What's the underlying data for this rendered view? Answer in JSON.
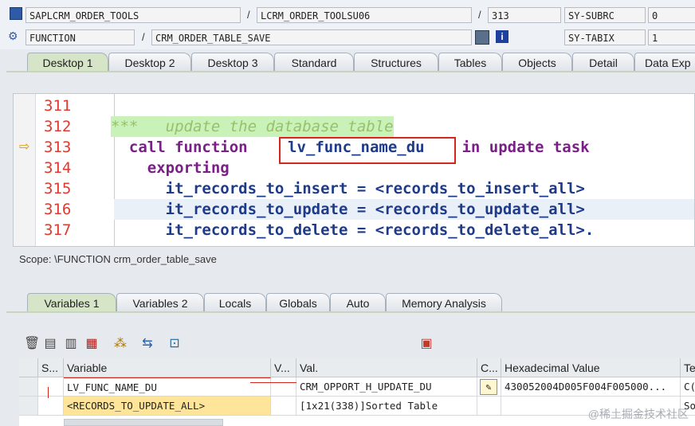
{
  "header": {
    "program": "SAPLCRM_ORDER_TOOLS",
    "include": "LCRM_ORDER_TOOLSU06",
    "line_no": "313",
    "subrc_label": "SY-SUBRC",
    "subrc_value": "0",
    "event_type": "FUNCTION",
    "event_name": "CRM_ORDER_TABLE_SAVE",
    "tabix_label": "SY-TABIX",
    "tabix_value": "1",
    "slash": "/"
  },
  "desktop_tabs": [
    "Desktop 1",
    "Desktop 2",
    "Desktop 3",
    "Standard",
    "Structures",
    "Tables",
    "Objects",
    "Detail",
    "Data Exp"
  ],
  "code_lines": [
    {
      "num": "311",
      "text": ""
    },
    {
      "num": "312",
      "text": "***   update the database table"
    },
    {
      "num": "313",
      "pre": "  call function ",
      "mid": "lv_func_name_du",
      "post": " in update task"
    },
    {
      "num": "314",
      "text": "    exporting"
    },
    {
      "num": "315",
      "text": "      it_records_to_insert = <records_to_insert_all>"
    },
    {
      "num": "316",
      "text": "      it_records_to_update = <records_to_update_all>"
    },
    {
      "num": "317",
      "text": "      it_records_to_delete = <records_to_delete_all>."
    }
  ],
  "scope": "Scope: \\FUNCTION crm_order_table_save",
  "variable_tabs": [
    "Variables 1",
    "Variables 2",
    "Locals",
    "Globals",
    "Auto",
    "Memory Analysis"
  ],
  "grid": {
    "headers": [
      "S...",
      "Variable",
      "V...",
      "Val.",
      "C...",
      "Hexadecimal Value",
      "Te"
    ],
    "rows": [
      {
        "variable": "LV_FUNC_NAME_DU",
        "value": "CRM_OPPORT_H_UPDATE_DU",
        "hex": "430052004D005F004F005000...",
        "te": "C("
      },
      {
        "variable": "<RECORDS_TO_UPDATE_ALL>",
        "value": "[1x21(338)]Sorted Table",
        "hex": "",
        "te": "So"
      }
    ]
  },
  "watermark": "@稀土掘金技术社区",
  "colors": {
    "line_number": "#e0392f",
    "keyword": "#7a1f87",
    "identifier": "#1e3a8a",
    "comment": "#9abf6b",
    "highlight_box": "#d6251c",
    "active_tab": "#d6e4c8"
  }
}
